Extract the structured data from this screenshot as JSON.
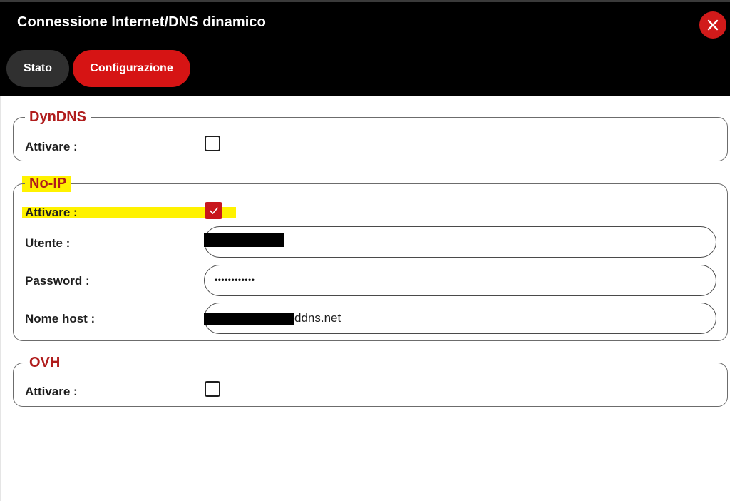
{
  "window": {
    "title": "Connessione Internet/DNS dinamico",
    "close_icon": "close-icon"
  },
  "tabs": [
    {
      "label": "Stato",
      "active": false
    },
    {
      "label": "Configurazione",
      "active": true
    }
  ],
  "colors": {
    "header_bg": "#000000",
    "accent_red": "#d61414",
    "inactive_tab": "#303030",
    "legend_red": "#b01c1c",
    "highlight": "#fff200"
  },
  "sections": {
    "dyndns": {
      "legend": "DynDNS",
      "activate_label": "Attivare :",
      "activate_checked": false
    },
    "noip": {
      "legend": "No-IP",
      "activate_label": "Attivare :",
      "activate_checked": true,
      "user_label": "Utente :",
      "password_label": "Password :",
      "password_value": "••••••••••••",
      "hostname_label": "Nome host :",
      "hostname_suffix": "ddns.net"
    },
    "ovh": {
      "legend": "OVH",
      "activate_label": "Attivare :",
      "activate_checked": false
    }
  }
}
